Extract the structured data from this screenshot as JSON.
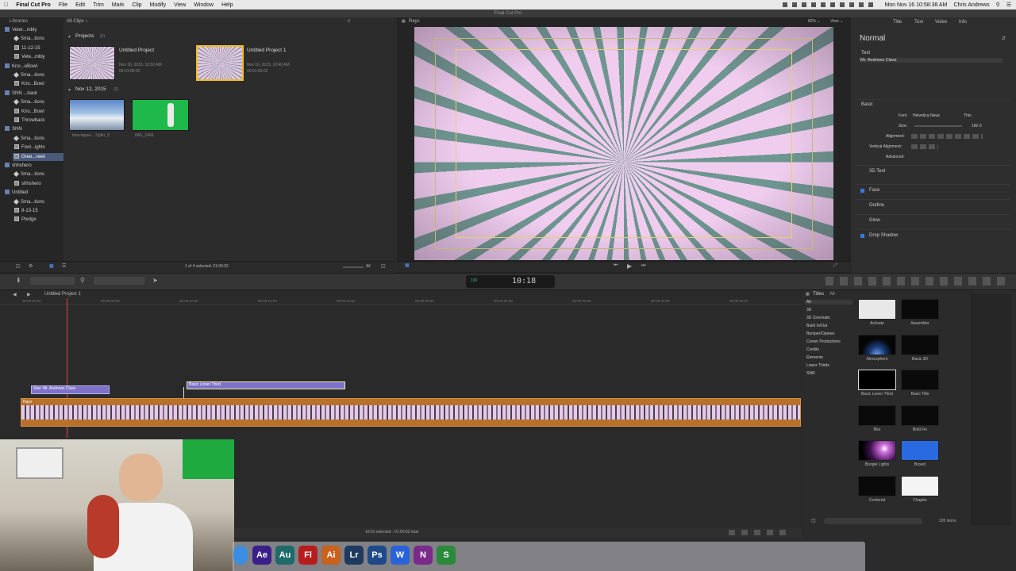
{
  "menubar": {
    "apple": "",
    "app_name": "Final Cut Pro",
    "items": [
      "File",
      "Edit",
      "Trim",
      "Mark",
      "Clip",
      "Modify",
      "View",
      "Window",
      "Help"
    ],
    "clock": "Mon Nov 16 10:58:38 AM",
    "user": "Chris Andrews"
  },
  "window_title": "Final Cut Pro",
  "libraries": {
    "header": "Libraries",
    "items": [
      {
        "label": "Veter...mbly",
        "type": "lib"
      },
      {
        "label": "Sma...tions",
        "type": "star"
      },
      {
        "label": "11-12-15",
        "type": "ev"
      },
      {
        "label": "Vete...mbly",
        "type": "ev"
      },
      {
        "label": "Kno...eBowl",
        "type": "lib"
      },
      {
        "label": "Sma...tions",
        "type": "star"
      },
      {
        "label": "Kno...Bowl",
        "type": "ev"
      },
      {
        "label": "SNN ...back",
        "type": "lib"
      },
      {
        "label": "Sma...tions",
        "type": "star"
      },
      {
        "label": "Kno...Bowl",
        "type": "ev"
      },
      {
        "label": "Throwback",
        "type": "ev"
      },
      {
        "label": "SNN",
        "type": "lib"
      },
      {
        "label": "Sma...tions",
        "type": "star"
      },
      {
        "label": "Foot...ights",
        "type": "ev"
      },
      {
        "label": "Gree...reen",
        "type": "ev",
        "selected": true
      },
      {
        "label": "shhshero",
        "type": "lib"
      },
      {
        "label": "Sma...tions",
        "type": "star"
      },
      {
        "label": "shhshero",
        "type": "ev"
      },
      {
        "label": "Untitled",
        "type": "lib"
      },
      {
        "label": "Sma...tions",
        "type": "star"
      },
      {
        "label": "8-13-15",
        "type": "ev"
      },
      {
        "label": "Pledge",
        "type": "ev"
      }
    ]
  },
  "browser": {
    "filter_label": "All Clips ↕",
    "projects_header": "Projects",
    "projects_count": "(2)",
    "project1_name": "Untitled Project",
    "project1_date": "Nov 16, 2015, 10:32 AM",
    "project1_dur": "00:01:00:02",
    "project2_name": "Untitled Project 1",
    "project2_date": "Nov 16, 2015, 10:40 AM",
    "project2_dur": "00:01:00:02",
    "date_header": "Nov 12, 2015",
    "date_count": "(2)",
    "clip1_name": "time-lapse-...7gifer_0",
    "clip2_name": "IMG_1466",
    "status": "1 of 4 selected, 01:00:02",
    "all_btn": "All"
  },
  "viewer": {
    "label": "Rays",
    "zoom": "82% ⌄",
    "view_btn": "View ⌄"
  },
  "inspector": {
    "tabs": [
      "Title",
      "Text",
      "Video",
      "Info"
    ],
    "preset": "Normal",
    "text_label": "Text",
    "text_value": "Mr. Andrews Class",
    "basic": "Basic",
    "font_label": "Font:",
    "font_value": "Helvetica Neue",
    "font_weight": "Thin",
    "size_label": "Size:",
    "size_value": "182.0",
    "alignment_label": "Alignment:",
    "valign_label": "Vertical Alignment:",
    "advanced_label": "Advanced:",
    "sections": [
      "3D Text",
      "Face",
      "Outline",
      "Glow",
      "Drop Shadow"
    ]
  },
  "toolbar": {
    "timecode": "10:18",
    "tc_prefix": "100"
  },
  "timeline": {
    "project_name": "Untitled Project 1",
    "ruler": [
      "00:00:00:00",
      "00:00:05:00",
      "00:00:10:00",
      "00:00:15:00",
      "00:00:20:00",
      "00:00:25:00",
      "00:00:30:00",
      "00:00:35:00",
      "00:00:40:00",
      "00:00:45:00"
    ],
    "title_clip1": "Star: Mr. Andrews Class",
    "title_clip2": "Basic Lower Third",
    "main_clip": "Rays",
    "status": "10:01 selected - 01:00:02 total"
  },
  "titles_browser": {
    "header": "Titles",
    "all_label": "All",
    "categories": [
      "All",
      "3D",
      "3D Cinematic",
      "Build In/Out",
      "Bumper/Opener",
      "Comer Productions",
      "Credits",
      "Elements",
      "Lower Thirds",
      "SNN"
    ],
    "items": [
      "Activate",
      "Assembler",
      "Atmosphere",
      "Basic 3D",
      "Basic Lower Third",
      "Basic Title",
      "Blur",
      "Bold Fin",
      "Boogie Lights",
      "Boxed",
      "Centered",
      "Chapter"
    ],
    "count": "205 items"
  },
  "dock": {
    "apps": [
      "Ae",
      "Au",
      "Fl",
      "Ai",
      "Lr",
      "Ps",
      "W",
      "N",
      "S"
    ]
  }
}
